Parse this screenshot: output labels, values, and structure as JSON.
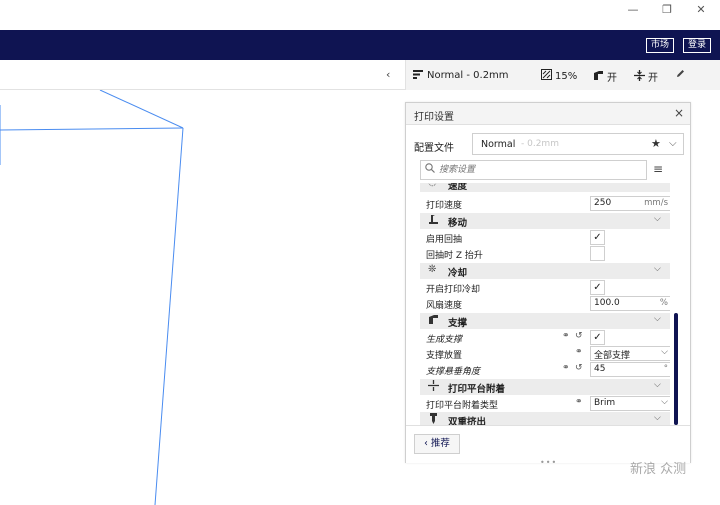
{
  "window": {
    "minimize": "—",
    "restore": "❐",
    "close": "✕"
  },
  "header": {
    "market": "市场",
    "login": "登录"
  },
  "toolbar": {
    "collapse": "‹",
    "profile": "Normal - 0.2mm",
    "infill": "15%",
    "support": "开",
    "adhesion": "开"
  },
  "panel": {
    "title": "打印设置",
    "close": "×",
    "profile_label": "配置文件",
    "profile_name": "Normal",
    "profile_sub": "- 0.2mm",
    "search_placeholder": "搜索设置",
    "recommend": "推荐",
    "resize": "•••",
    "rows": {
      "cat_speed": "速度",
      "print_speed": {
        "label": "打印速度",
        "value": "250",
        "unit": "mm/s"
      },
      "cat_travel": "移动",
      "enable_retraction": "启用回抽",
      "z_hop": "回抽时 Z 抬升",
      "cat_cooling": "冷却",
      "enable_cooling": "开启打印冷却",
      "fan_speed": {
        "label": "风扇速度",
        "value": "100.0",
        "unit": "%"
      },
      "cat_support": "支撑",
      "generate_support": "生成支撑",
      "support_placement": {
        "label": "支撑放置",
        "value": "全部支撑"
      },
      "overhang_angle": {
        "label": "支撑悬垂角度",
        "value": "45",
        "unit": "°"
      },
      "cat_adhesion": "打印平台附着",
      "adhesion_type": {
        "label": "打印平台附着类型",
        "value": "Brim"
      },
      "cat_dual": "双重挤出"
    }
  },
  "watermark": "新浪 众测"
}
